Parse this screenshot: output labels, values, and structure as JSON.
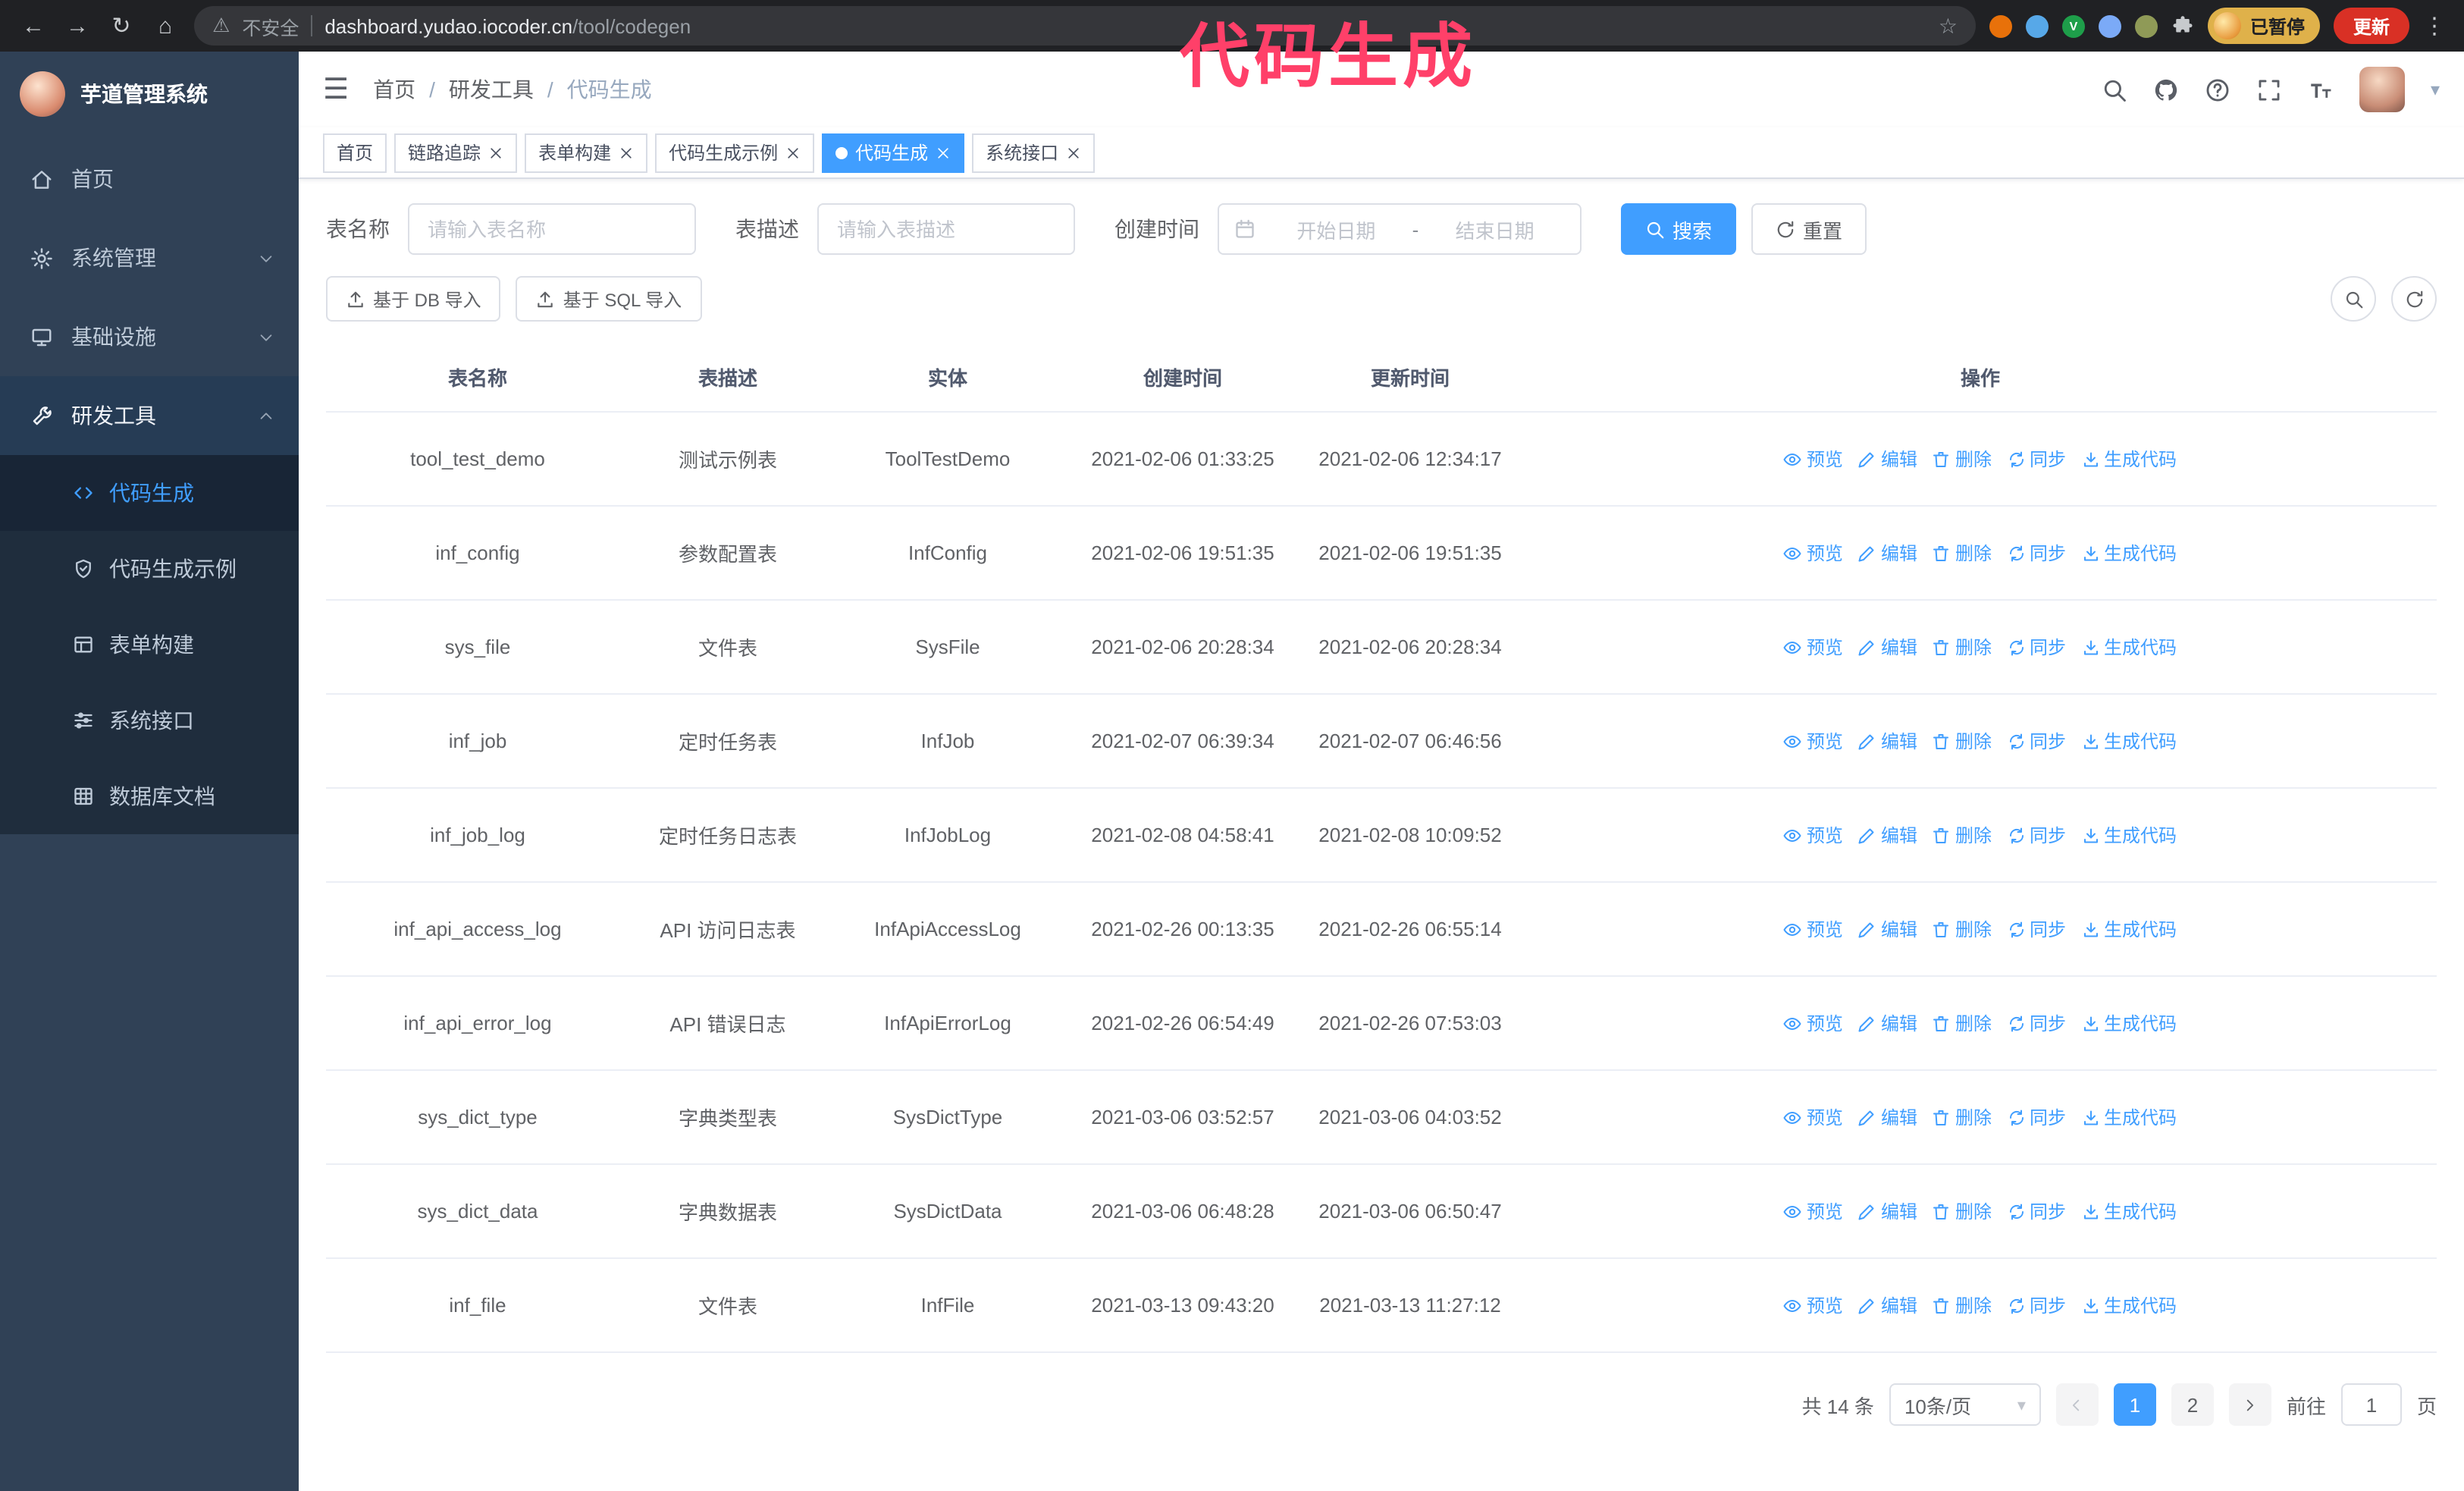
{
  "browser": {
    "security_warning": "不安全",
    "url_domain": "dashboard.yudao.iocoder.cn",
    "url_path": "/tool/codegen",
    "profile_chip": "已暂停",
    "update_button": "更新"
  },
  "annotation": "代码生成",
  "icons": {
    "back": "←",
    "forward": "→",
    "reload": "↻",
    "home": "⌂",
    "warning": "⚠",
    "star": "☆",
    "kebab": "⋮",
    "caret_down": "▾",
    "fold": "☰"
  },
  "sidebar": {
    "title": "芋道管理系统",
    "items": [
      {
        "label": "首页"
      },
      {
        "label": "系统管理"
      },
      {
        "label": "基础设施"
      },
      {
        "label": "研发工具"
      }
    ],
    "submenu": [
      {
        "label": "代码生成"
      },
      {
        "label": "代码生成示例"
      },
      {
        "label": "表单构建"
      },
      {
        "label": "系统接口"
      },
      {
        "label": "数据库文档"
      }
    ]
  },
  "breadcrumb": {
    "items": [
      "首页",
      "研发工具",
      "代码生成"
    ],
    "separator": "/"
  },
  "tabs": [
    {
      "label": "首页"
    },
    {
      "label": "链路追踪"
    },
    {
      "label": "表单构建"
    },
    {
      "label": "代码生成示例"
    },
    {
      "label": "代码生成"
    },
    {
      "label": "系统接口"
    }
  ],
  "filters": {
    "table_name_label": "表名称",
    "table_name_placeholder": "请输入表名称",
    "table_desc_label": "表描述",
    "table_desc_placeholder": "请输入表描述",
    "create_time_label": "创建时间",
    "start_placeholder": "开始日期",
    "range_separator": "-",
    "end_placeholder": "结束日期",
    "search_button": "搜索",
    "reset_button": "重置"
  },
  "toolbar": {
    "import_db": "基于 DB 导入",
    "import_sql": "基于 SQL 导入"
  },
  "table": {
    "columns": [
      "表名称",
      "表描述",
      "实体",
      "创建时间",
      "更新时间",
      "操作"
    ],
    "actions": [
      "预览",
      "编辑",
      "删除",
      "同步",
      "生成代码"
    ],
    "rows": [
      {
        "name": "tool_test_demo",
        "desc": "测试示例表",
        "entity": "ToolTestDemo",
        "created": "2021-02-06 01:33:25",
        "updated": "2021-02-06 12:34:17"
      },
      {
        "name": "inf_config",
        "desc": "参数配置表",
        "entity": "InfConfig",
        "created": "2021-02-06 19:51:35",
        "updated": "2021-02-06 19:51:35"
      },
      {
        "name": "sys_file",
        "desc": "文件表",
        "entity": "SysFile",
        "created": "2021-02-06 20:28:34",
        "updated": "2021-02-06 20:28:34"
      },
      {
        "name": "inf_job",
        "desc": "定时任务表",
        "entity": "InfJob",
        "created": "2021-02-07 06:39:34",
        "updated": "2021-02-07 06:46:56"
      },
      {
        "name": "inf_job_log",
        "desc": "定时任务日志表",
        "entity": "InfJobLog",
        "created": "2021-02-08 04:58:41",
        "updated": "2021-02-08 10:09:52"
      },
      {
        "name": "inf_api_access_log",
        "desc": "API 访问日志表",
        "entity": "InfApiAccessLog",
        "created": "2021-02-26 00:13:35",
        "updated": "2021-02-26 06:55:14"
      },
      {
        "name": "inf_api_error_log",
        "desc": "API 错误日志",
        "entity": "InfApiErrorLog",
        "created": "2021-02-26 06:54:49",
        "updated": "2021-02-26 07:53:03"
      },
      {
        "name": "sys_dict_type",
        "desc": "字典类型表",
        "entity": "SysDictType",
        "created": "2021-03-06 03:52:57",
        "updated": "2021-03-06 04:03:52"
      },
      {
        "name": "sys_dict_data",
        "desc": "字典数据表",
        "entity": "SysDictData",
        "created": "2021-03-06 06:48:28",
        "updated": "2021-03-06 06:50:47"
      },
      {
        "name": "inf_file",
        "desc": "文件表",
        "entity": "InfFile",
        "created": "2021-03-13 09:43:20",
        "updated": "2021-03-13 11:27:12"
      }
    ]
  },
  "pagination": {
    "total": "共 14 条",
    "page_size": "10条/页",
    "pages": [
      "1",
      "2"
    ],
    "active_page": "1",
    "goto_label": "前往",
    "goto_value": "1",
    "page_unit": "页"
  },
  "colors": {
    "accent": "#409EFF",
    "sidebar_bg": "#304156",
    "submenu_bg": "#1F2D3D",
    "annotation": "#FF4069"
  }
}
